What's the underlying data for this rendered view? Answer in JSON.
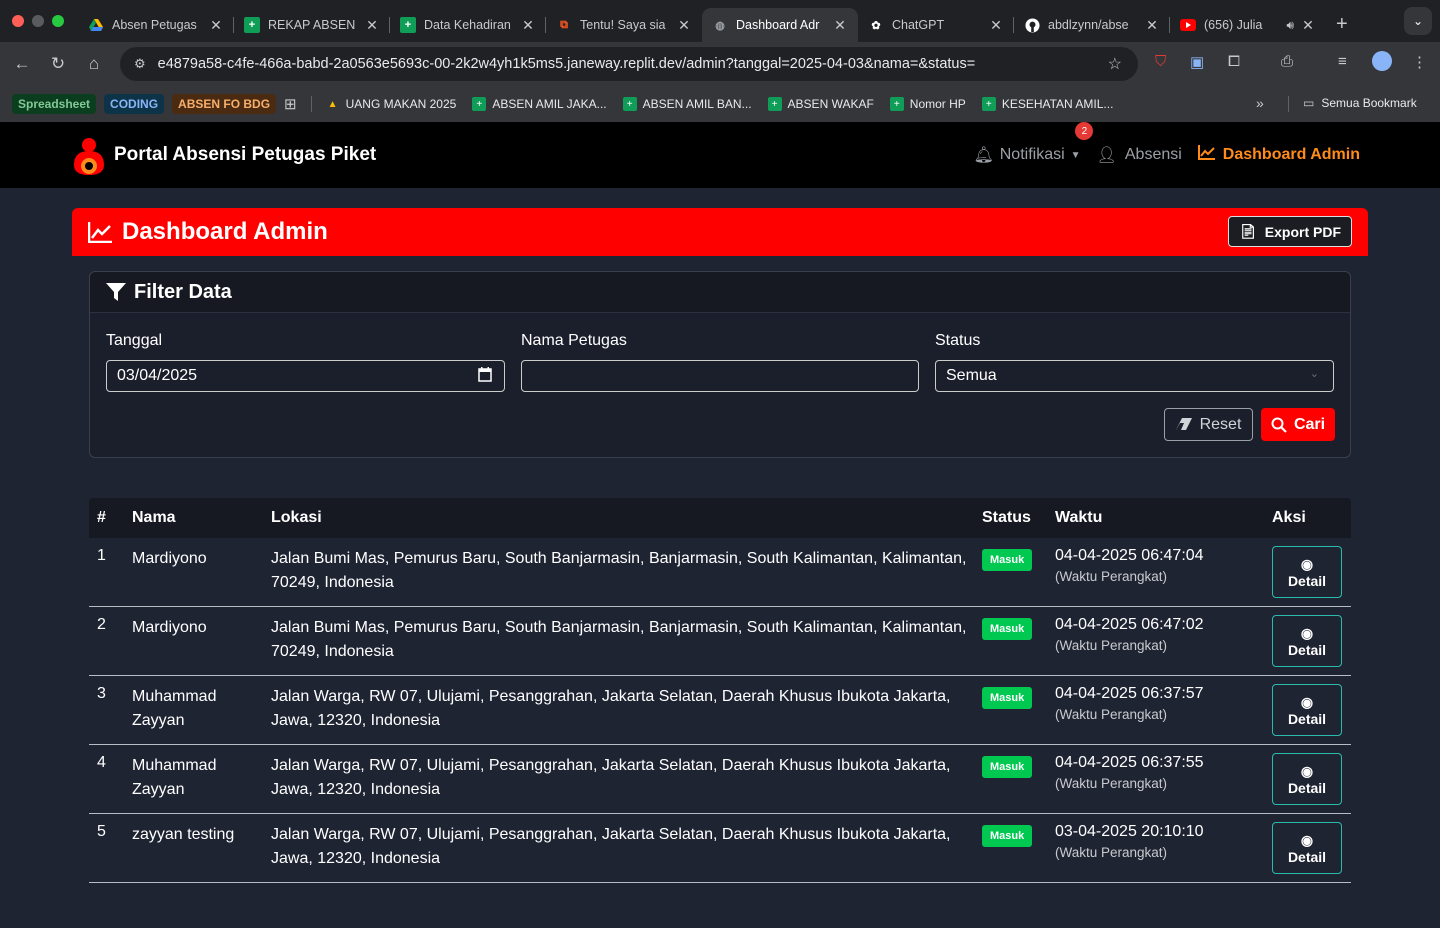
{
  "browser": {
    "tabs": [
      {
        "title": "Absen Petugas",
        "icon_color": "#fbbc04",
        "icon": "drive-icon"
      },
      {
        "title": "REKAP ABSEN",
        "icon_color": "#0f9d58",
        "icon": "sheets-icon"
      },
      {
        "title": "Data Kehadiran",
        "icon_color": "#0f9d58",
        "icon": "sheets-icon"
      },
      {
        "title": "Tentu! Saya sia",
        "icon_color": "#ff5722",
        "icon": "replit-icon"
      },
      {
        "title": "Dashboard Adr",
        "icon_color": "#9aa0a6",
        "icon": "globe-icon"
      },
      {
        "title": "ChatGPT",
        "icon_color": "#ffffff",
        "icon": "chatgpt-icon"
      },
      {
        "title": "abdlzynn/abse",
        "icon_color": "#ffffff",
        "icon": "github-icon"
      },
      {
        "title": "(656) Julia",
        "icon_color": "#ff0000",
        "icon": "youtube-icon"
      }
    ],
    "url": "e4879a58-c4fe-466a-babd-2a0563e5693c-00-2k2w4yh1k5ms5.janeway.replit.dev/admin?tanggal=2025-04-03&nama=&status=",
    "bookmarks_pills": [
      {
        "label": "Spreadsheet",
        "bg": "#0b3d1f",
        "color": "#81c995"
      },
      {
        "label": "CODING",
        "bg": "#0d3348",
        "color": "#8ab4f8"
      },
      {
        "label": "ABSEN FO BDG",
        "bg": "#4a2b12",
        "color": "#f6ae6b"
      }
    ],
    "bookmarks": [
      {
        "label": "UANG MAKAN 2025",
        "color": "#fbbc04"
      },
      {
        "label": "ABSEN AMIL JAKA...",
        "color": "#0f9d58"
      },
      {
        "label": "ABSEN AMIL BAN...",
        "color": "#0f9d58"
      },
      {
        "label": "ABSEN WAKAF",
        "color": "#0f9d58"
      },
      {
        "label": "Nomor HP",
        "color": "#0f9d58"
      },
      {
        "label": "KESEHATAN AMIL...",
        "color": "#0f9d58"
      }
    ],
    "all_bookmarks": "Semua Bookmark"
  },
  "nav": {
    "brand": "Portal Absensi Petugas Piket",
    "notif_label": "Notifikasi",
    "notif_count": "2",
    "absensi_label": "Absensi",
    "dashboard_label": "Dashboard Admin"
  },
  "header": {
    "title": "Dashboard Admin",
    "export_label": "Export PDF"
  },
  "filter": {
    "title": "Filter Data",
    "tanggal_label": "Tanggal",
    "tanggal_value": "03/04/2025",
    "nama_label": "Nama Petugas",
    "nama_value": "",
    "status_label": "Status",
    "status_value": "Semua",
    "reset_label": "Reset",
    "cari_label": "Cari"
  },
  "table": {
    "headers": {
      "no": "#",
      "nama": "Nama",
      "lokasi": "Lokasi",
      "status": "Status",
      "waktu": "Waktu",
      "aksi": "Aksi"
    },
    "rows": [
      {
        "no": "1",
        "nama": "Mardiyono",
        "lokasi": "Jalan Bumi Mas, Pemurus Baru, South Banjarmasin, Banjarmasin, South Kalimantan, Kalimantan, 70249, Indonesia",
        "status": "Masuk",
        "waktu": "04-04-2025 06:47:04",
        "waktu_sub": "(Waktu Perangkat)",
        "aksi": "Detail"
      },
      {
        "no": "2",
        "nama": "Mardiyono",
        "lokasi": "Jalan Bumi Mas, Pemurus Baru, South Banjarmasin, Banjarmasin, South Kalimantan, Kalimantan, 70249, Indonesia",
        "status": "Masuk",
        "waktu": "04-04-2025 06:47:02",
        "waktu_sub": "(Waktu Perangkat)",
        "aksi": "Detail"
      },
      {
        "no": "3",
        "nama": "Muhammad Zayyan",
        "lokasi": "Jalan Warga, RW 07, Ulujami, Pesanggrahan, Jakarta Selatan, Daerah Khusus Ibukota Jakarta, Jawa, 12320, Indonesia",
        "status": "Masuk",
        "waktu": "04-04-2025 06:37:57",
        "waktu_sub": "(Waktu Perangkat)",
        "aksi": "Detail"
      },
      {
        "no": "4",
        "nama": "Muhammad Zayyan",
        "lokasi": "Jalan Warga, RW 07, Ulujami, Pesanggrahan, Jakarta Selatan, Daerah Khusus Ibukota Jakarta, Jawa, 12320, Indonesia",
        "status": "Masuk",
        "waktu": "04-04-2025 06:37:55",
        "waktu_sub": "(Waktu Perangkat)",
        "aksi": "Detail"
      },
      {
        "no": "5",
        "nama": "zayyan testing",
        "lokasi": "Jalan Warga, RW 07, Ulujami, Pesanggrahan, Jakarta Selatan, Daerah Khusus Ibukota Jakarta, Jawa, 12320, Indonesia",
        "status": "Masuk",
        "waktu": "03-04-2025 20:10:10",
        "waktu_sub": "(Waktu Perangkat)",
        "aksi": "Detail"
      }
    ]
  },
  "colors": {
    "accent": "#ff0000",
    "active_nav": "#ff8c1a",
    "masuk": "#00c851"
  }
}
